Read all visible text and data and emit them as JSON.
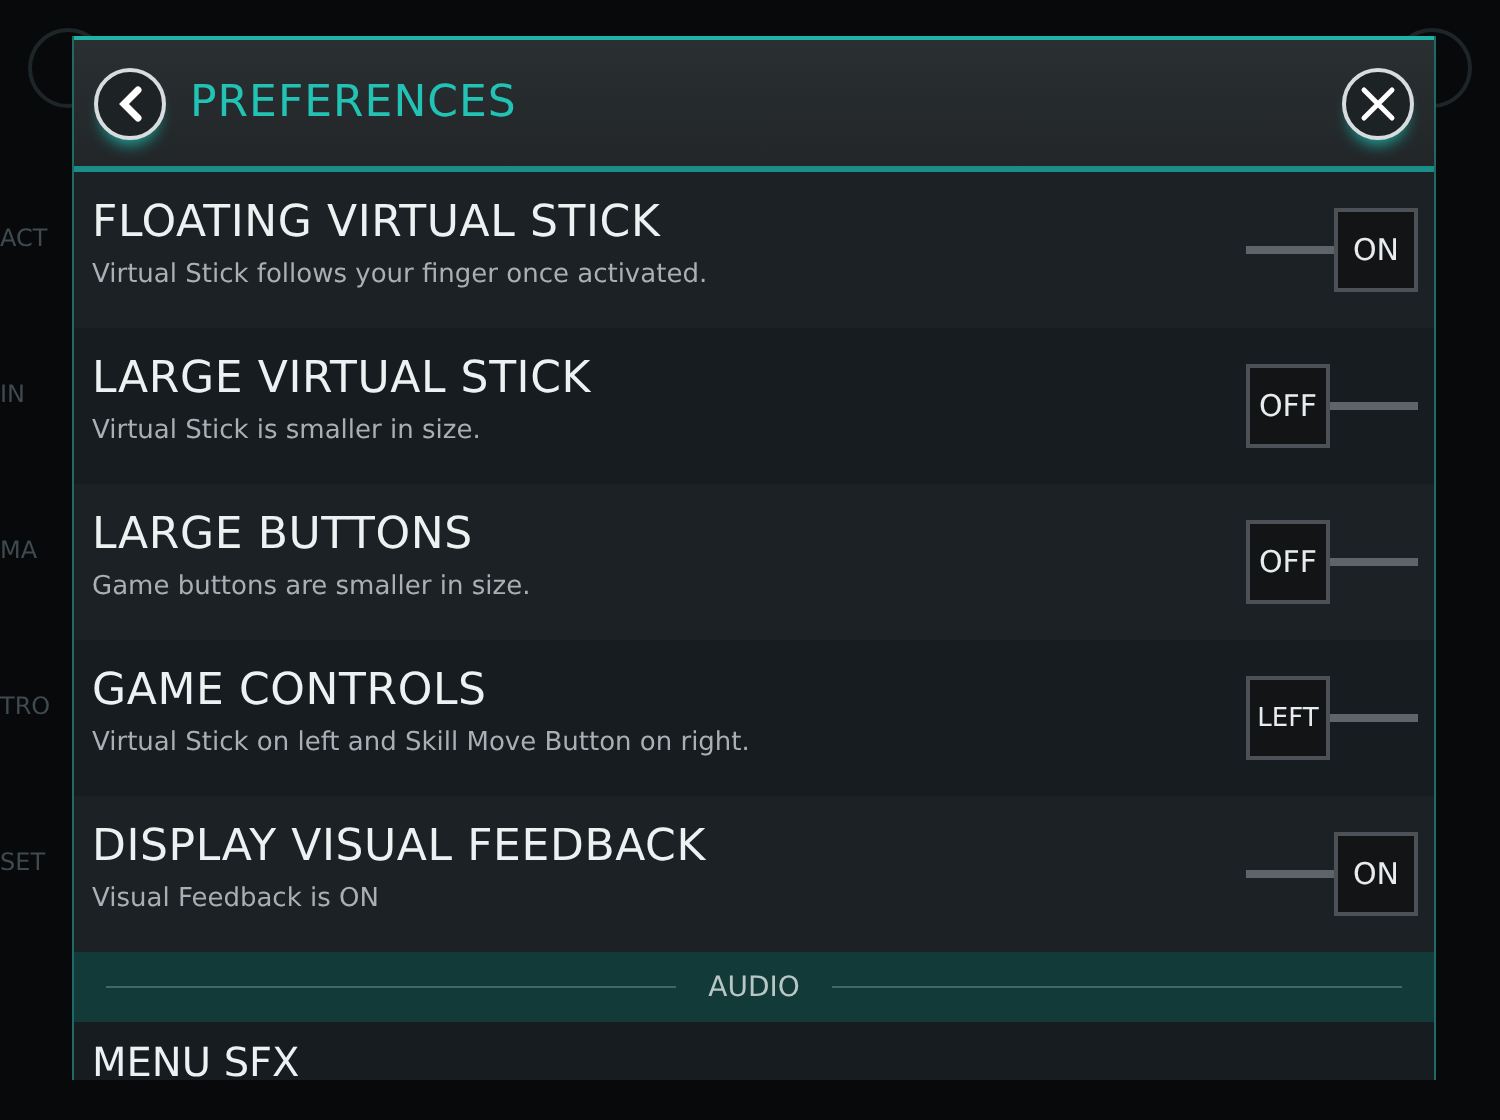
{
  "backdrop": {
    "sidebar_labels": [
      "ACT",
      "IN",
      "MA",
      "TRO",
      "SET"
    ]
  },
  "dialog": {
    "title": "PREFERENCES"
  },
  "settings": [
    {
      "title": "FLOATING VIRTUAL STICK",
      "description": "Virtual Stick follows your finger once activated.",
      "toggle": {
        "label": "ON",
        "on": true
      }
    },
    {
      "title": "LARGE VIRTUAL STICK",
      "description": "Virtual Stick is smaller in size.",
      "toggle": {
        "label": "OFF",
        "on": false
      }
    },
    {
      "title": "LARGE BUTTONS",
      "description": "Game buttons are smaller in size.",
      "toggle": {
        "label": "OFF",
        "on": false
      }
    },
    {
      "title": "GAME CONTROLS",
      "description": "Virtual Stick on left and Skill Move Button on right.",
      "toggle": {
        "label": "LEFT",
        "on": false
      }
    },
    {
      "title": "DISPLAY VISUAL FEEDBACK",
      "description": "Visual Feedback is ON",
      "toggle": {
        "label": "ON",
        "on": true
      }
    }
  ],
  "section_header": "AUDIO",
  "next_setting": {
    "title": "MENU SFX"
  }
}
